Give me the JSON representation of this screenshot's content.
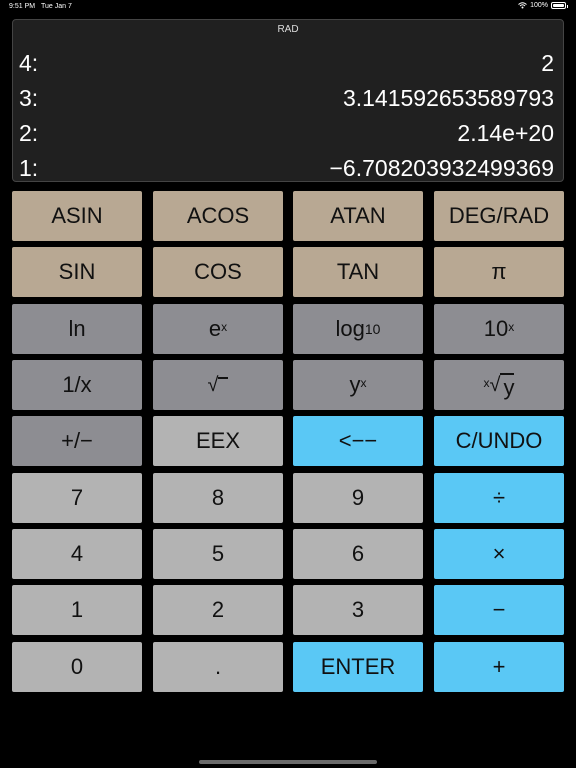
{
  "status": {
    "time": "9:51 PM",
    "date": "Tue Jan 7",
    "battery": "100%"
  },
  "display": {
    "mode": "RAD",
    "stack": [
      {
        "label": "4:",
        "value": "2"
      },
      {
        "label": "3:",
        "value": "3.141592653589793"
      },
      {
        "label": "2:",
        "value": "2.14e+20"
      },
      {
        "label": "1:",
        "value": "−6.708203932499369"
      }
    ]
  },
  "keys": {
    "asin": "ASIN",
    "acos": "ACOS",
    "atan": "ATAN",
    "degrad": "DEG/RAD",
    "sin": "SIN",
    "cos": "COS",
    "tan": "TAN",
    "pi": "π",
    "ln": "ln",
    "exp_base": "e",
    "exp_sup": "x",
    "log_base": "log",
    "log_sub": "10",
    "pow10_base": "10",
    "pow10_sup": "x",
    "recip": "1/x",
    "sqrt": "√",
    "ypow_base": "y",
    "ypow_sup": "x",
    "xroot_sup": "x",
    "xroot_symbol": "√",
    "xroot_base": "y",
    "neg": "+/−",
    "eex": "EEX",
    "backspace": "<−−",
    "clear": "C/UNDO",
    "d7": "7",
    "d8": "8",
    "d9": "9",
    "divide": "÷",
    "d4": "4",
    "d5": "5",
    "d6": "6",
    "multiply": "×",
    "d1": "1",
    "d2": "2",
    "d3": "3",
    "subtract": "−",
    "d0": "0",
    "dot": ".",
    "enter": "ENTER",
    "add": "+"
  },
  "colors": {
    "tan": "#b8a893",
    "dark_gray": "#8d8d92",
    "light_gray": "#b3b3b3",
    "blue": "#5ac8f5"
  }
}
